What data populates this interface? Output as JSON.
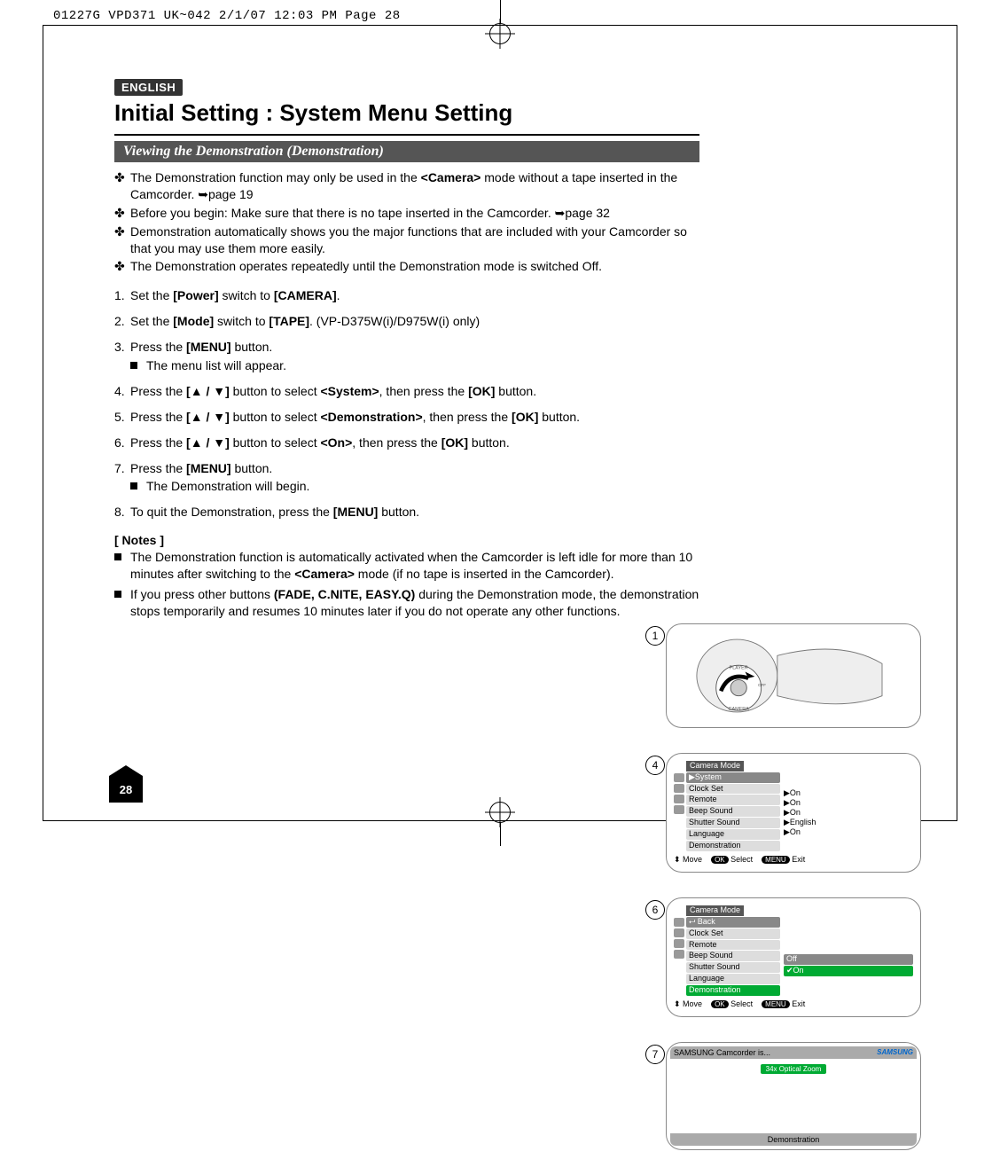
{
  "crop_header": "01227G VPD371 UK~042  2/1/07 12:03 PM  Page 28",
  "lang_badge": "ENGLISH",
  "page_title": "Initial Setting : System Menu Setting",
  "section_bar": "Viewing the Demonstration (Demonstration)",
  "page_number": "28",
  "intro_bullets": [
    "The Demonstration function may only be used in the <Camera> mode without a tape inserted in the Camcorder. ➥page 19",
    "Before you begin: Make sure that there is no tape inserted in the Camcorder. ➥page 32",
    "Demonstration automatically shows you the major functions that are included with your Camcorder so that you may use them more easily.",
    "The Demonstration operates repeatedly until the Demonstration mode is switched Off."
  ],
  "steps": [
    {
      "text": "Set the [Power] switch to [CAMERA].",
      "sub": []
    },
    {
      "text": "Set the [Mode] switch to [TAPE]. (VP-D375W(i)/D975W(i) only)",
      "sub": []
    },
    {
      "text": "Press the [MENU] button.",
      "sub": [
        "The menu list will appear."
      ]
    },
    {
      "text": "Press the [▲ / ▼] button to select <System>, then press the [OK] button.",
      "sub": []
    },
    {
      "text": "Press the [▲ / ▼] button to select <Demonstration>, then press the [OK] button.",
      "sub": []
    },
    {
      "text": "Press the [▲ / ▼] button to select <On>, then press the [OK] button.",
      "sub": []
    },
    {
      "text": "Press the [MENU] button.",
      "sub": [
        "The Demonstration will begin."
      ]
    },
    {
      "text": "To quit the Demonstration, press the [MENU] button.",
      "sub": []
    }
  ],
  "notes_head": "[ Notes ]",
  "notes": [
    "The Demonstration function is automatically activated when the Camcorder is left idle for more than 10 minutes after switching to the <Camera> mode (if no tape is inserted in the Camcorder).",
    "If you press other buttons (FADE, C.NITE, EASY.Q) during the Demonstration mode, the demonstration stops temporarily and resumes 10 minutes later if you do not operate any other functions."
  ],
  "fig1": {
    "num": "1",
    "dial_labels": {
      "top": "PLAYER",
      "mid": "OFF",
      "bottom": "CAMERA"
    }
  },
  "fig4": {
    "num": "4",
    "title": "Camera Mode",
    "header": "▶System",
    "items": [
      "Clock Set",
      "Remote",
      "Beep Sound",
      "Shutter Sound",
      "Language",
      "Demonstration"
    ],
    "values": [
      "",
      "▶On",
      "▶On",
      "▶On",
      "▶English",
      "▶On"
    ],
    "foot": {
      "move": "Move",
      "select": "Select",
      "exit": "Exit",
      "ok": "OK",
      "menu": "MENU"
    }
  },
  "fig6": {
    "num": "6",
    "title": "Camera Mode",
    "header": "⮠ Back",
    "items": [
      "Clock Set",
      "Remote",
      "Beep Sound",
      "Shutter Sound",
      "Language",
      "Demonstration"
    ],
    "options": {
      "off": "Off",
      "on": "✔On"
    },
    "foot": {
      "move": "Move",
      "select": "Select",
      "exit": "Exit",
      "ok": "OK",
      "menu": "MENU"
    }
  },
  "fig7": {
    "num": "7",
    "head": "SAMSUNG Camcorder is...",
    "brand": "SAMSUNG",
    "zoom": "34x Optical Zoom",
    "foot": "Demonstration"
  }
}
